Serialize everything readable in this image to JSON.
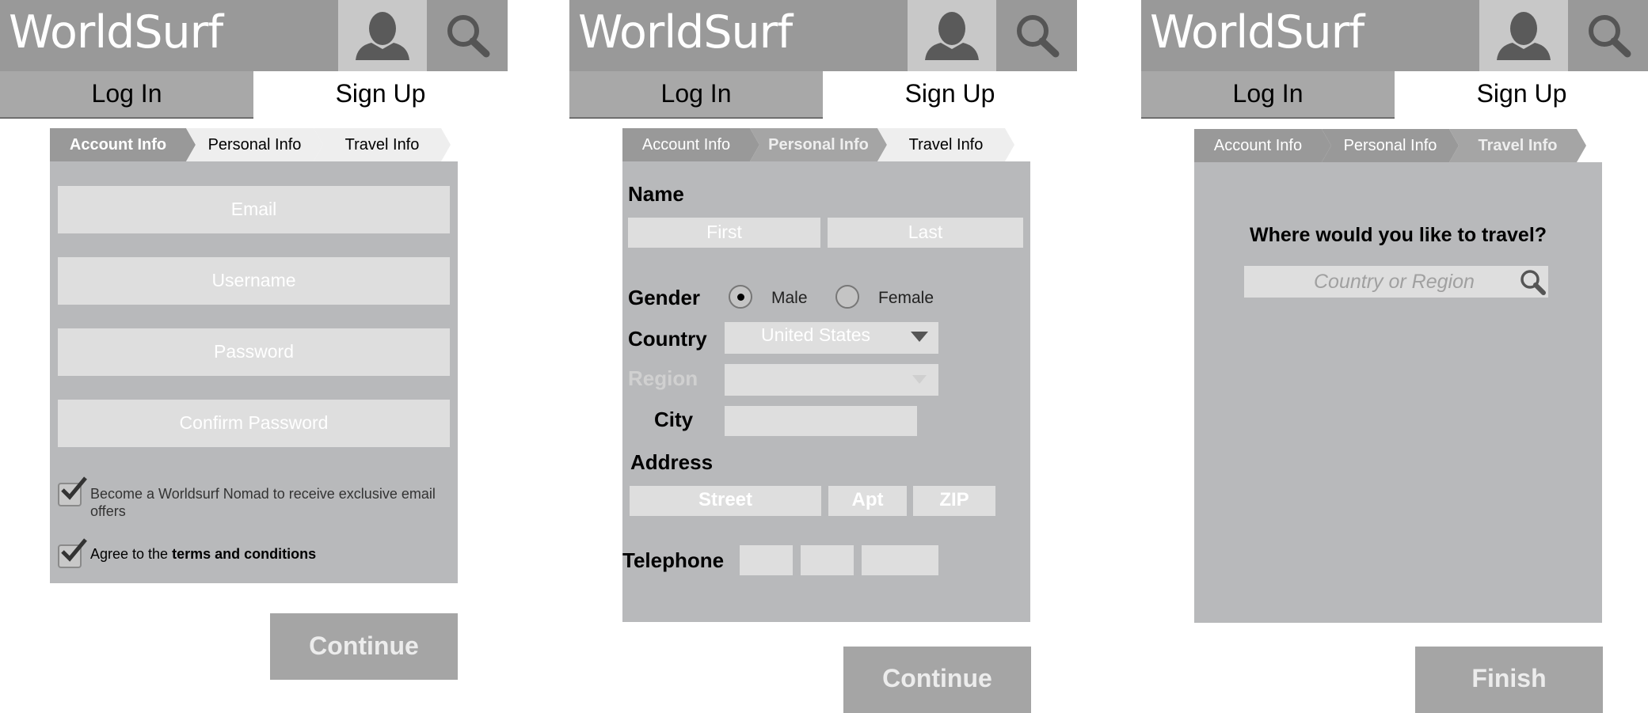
{
  "app": {
    "brand": "WorldSurf",
    "icons": {
      "user": "user-silhouette-icon",
      "search": "magnifier-icon"
    },
    "tabs": {
      "login": "Log In",
      "signup": "Sign Up"
    },
    "steps": {
      "account": "Account Info",
      "personal": "Personal Info",
      "travel": "Travel Info"
    },
    "colors": {
      "header": "#999999",
      "panel": "#b8b9bb",
      "field": "#dedede",
      "button": "#a5a5a5",
      "active_step": "#999999",
      "inactive_step": "#eeeeee"
    }
  },
  "account_screen": {
    "active_step": "Account Info",
    "fields": {
      "email": "Email",
      "username": "Username",
      "password": "Password",
      "confirm_password": "Confirm Password"
    },
    "nomad_checkbox": {
      "checked": true,
      "label": "Become a Worldsurf Nomad to receive exclusive email offers"
    },
    "terms_checkbox": {
      "checked": true,
      "label_prefix": "Agree to the ",
      "label_link": "terms and conditions"
    },
    "continue_button": "Continue"
  },
  "personal_screen": {
    "active_step": "Personal Info",
    "name_label": "Name",
    "first_placeholder": "First",
    "last_placeholder": "Last",
    "gender_label": "Gender",
    "gender_options": [
      {
        "label": "Male",
        "selected": true
      },
      {
        "label": "Female",
        "selected": false
      }
    ],
    "country_label": "Country",
    "country_value": "United States",
    "region_label": "Region",
    "region_value": "",
    "city_label": "City",
    "city_value": "",
    "address_label": "Address",
    "street_placeholder": "Street",
    "apt_placeholder": "Apt",
    "zip_placeholder": "ZIP",
    "telephone_label": "Telephone",
    "continue_button": "Continue"
  },
  "travel_screen": {
    "active_step": "Travel Info",
    "question": "Where would you like to travel?",
    "search_placeholder": "Country or Region",
    "finish_button": "Finish"
  }
}
